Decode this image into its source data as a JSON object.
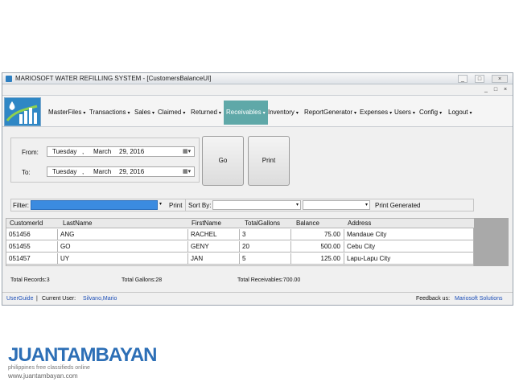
{
  "window": {
    "title": "MARIOSOFT WATER REFILLING SYSTEM - [CustomersBalanceUI]",
    "controls": [
      "_",
      "□",
      "×"
    ],
    "mdi_controls": [
      "_",
      "□",
      "×"
    ]
  },
  "menu": {
    "items": [
      {
        "label": "MasterFiles",
        "active": false
      },
      {
        "label": "Transactions",
        "active": false
      },
      {
        "label": "Sales",
        "active": false
      },
      {
        "label": "Claimed",
        "active": false
      },
      {
        "label": "Returned",
        "active": false
      },
      {
        "label": "Receivables",
        "active": true
      },
      {
        "label": "Inventory",
        "active": false
      },
      {
        "label": "ReportGenerator",
        "active": false
      },
      {
        "label": "Expenses",
        "active": false
      },
      {
        "label": "Users",
        "active": false
      },
      {
        "label": "Config",
        "active": false
      },
      {
        "label": "Logout",
        "active": false
      }
    ],
    "caret": "▾"
  },
  "dates": {
    "from_label": "From:",
    "to_label": "To:",
    "from": {
      "day": "Tuesday",
      "sep": ",",
      "month": "March",
      "date": "29, 2016"
    },
    "to": {
      "day": "Tuesday",
      "sep": ",",
      "month": "March",
      "date": "29, 2016"
    },
    "cal_icon": "▦▾"
  },
  "buttons": {
    "go": "Go",
    "print": "Print"
  },
  "filter": {
    "label": "Filter:",
    "value": "",
    "print": "Print",
    "sort_label": "Sort By:",
    "print_generated": "Print Generated",
    "arrow": "▾"
  },
  "grid": {
    "columns": [
      "CustomerId",
      "LastName",
      "FirstName",
      "TotalGallons",
      "Balance",
      "Address"
    ],
    "rows": [
      {
        "id": "051456",
        "last": "ANG",
        "first": "RACHEL",
        "gallons": "3",
        "balance": "75.00",
        "address": "Mandaue City"
      },
      {
        "id": "051455",
        "last": "GO",
        "first": "GENY",
        "gallons": "20",
        "balance": "500.00",
        "address": "Cebu City"
      },
      {
        "id": "051457",
        "last": "UY",
        "first": "JAN",
        "gallons": "5",
        "balance": "125.00",
        "address": "Lapu-Lapu City"
      }
    ]
  },
  "totals": {
    "records": "Total Records:3",
    "gallons": "Total Gallons:28",
    "receivables": "Total Receivables:700.00"
  },
  "status": {
    "userguide": "UserGuide",
    "sep": "|",
    "current_user_label": "Current User:",
    "current_user": "Silvano,Mario",
    "feedback_label": "Feedback us:",
    "feedback_link": "Mariosoft Solutions"
  },
  "watermark": {
    "brand": "JUANTAMBAYAN",
    "tagline": "philippines  free classifieds online",
    "url": "www.juantambayan.com"
  },
  "colors": {
    "active_menu": "#5fa8a8",
    "filter_input": "#3b8be0",
    "link": "#1d4fb8"
  }
}
